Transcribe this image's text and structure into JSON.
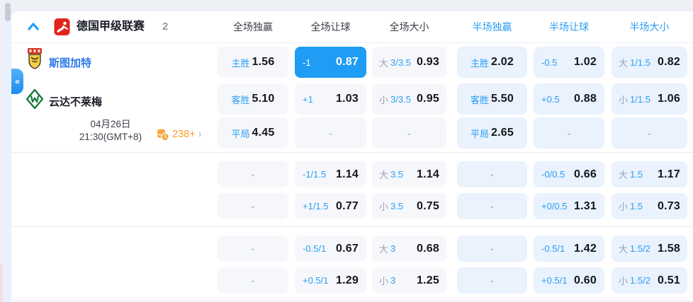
{
  "colors": {
    "accent_blue": "#1f9cf3",
    "label_blue": "#2b9ef3",
    "orange": "#f79e2e",
    "cell_ft_bg": "#f6f7fb",
    "cell_ht_bg": "#e9f2fd"
  },
  "icons": {
    "collapse_left": "«",
    "chevron_right": "›"
  },
  "header": {
    "league": "德国甲级联赛",
    "count": "2",
    "columns": [
      "全场独赢",
      "全场让球",
      "全场大小",
      "半场独赢",
      "半场让球",
      "半场大小"
    ]
  },
  "teams": {
    "home": {
      "name": "斯图加特"
    },
    "away": {
      "name": "云达不莱梅"
    }
  },
  "schedule": {
    "date": "04月26日",
    "time": "21:30(GMT+8)"
  },
  "markets": {
    "count_label": "238+"
  },
  "odds": {
    "rows": [
      {
        "cells": [
          {
            "label": "主胜",
            "value": "1.56"
          },
          {
            "label": "-1",
            "value": "0.87"
          },
          {
            "side": "大",
            "line": "3/3.5",
            "value": "0.93"
          },
          {
            "label": "主胜",
            "value": "2.02"
          },
          {
            "label": "-0.5",
            "value": "1.02"
          },
          {
            "side": "大",
            "line": "1/1.5",
            "value": "0.82"
          }
        ]
      },
      {
        "cells": [
          {
            "label": "客胜",
            "value": "5.10"
          },
          {
            "label": "+1",
            "value": "1.03"
          },
          {
            "side": "小",
            "line": "3/3.5",
            "value": "0.95"
          },
          {
            "label": "客胜",
            "value": "5.50"
          },
          {
            "label": "+0.5",
            "value": "0.88"
          },
          {
            "side": "小",
            "line": "1/1.5",
            "value": "1.06"
          }
        ]
      },
      {
        "cells": [
          {
            "label": "平局",
            "value": "4.45"
          },
          {
            "value": "-"
          },
          {
            "value": "-"
          },
          {
            "label": "平局",
            "value": "2.65"
          },
          {
            "value": "-"
          },
          {
            "value": "-"
          }
        ]
      },
      {
        "cells": [
          {
            "value": "-"
          },
          {
            "label": "-1/1.5",
            "value": "1.14"
          },
          {
            "side": "大",
            "line": "3.5",
            "value": "1.14"
          },
          {
            "value": "-"
          },
          {
            "label": "-0/0.5",
            "value": "0.66"
          },
          {
            "side": "大",
            "line": "1.5",
            "value": "1.17"
          }
        ]
      },
      {
        "cells": [
          {
            "value": "-"
          },
          {
            "label": "+1/1.5",
            "value": "0.77"
          },
          {
            "side": "小",
            "line": "3.5",
            "value": "0.75"
          },
          {
            "value": "-"
          },
          {
            "label": "+0/0.5",
            "value": "1.31"
          },
          {
            "side": "小",
            "line": "1.5",
            "value": "0.73"
          }
        ]
      },
      {
        "cells": [
          {
            "value": "-"
          },
          {
            "label": "-0.5/1",
            "value": "0.67"
          },
          {
            "side": "大",
            "line": "3",
            "value": "0.68"
          },
          {
            "value": "-"
          },
          {
            "label": "-0.5/1",
            "value": "1.42"
          },
          {
            "side": "大",
            "line": "1.5/2",
            "value": "1.58"
          }
        ]
      },
      {
        "cells": [
          {
            "value": "-"
          },
          {
            "label": "+0.5/1",
            "value": "1.29"
          },
          {
            "side": "小",
            "line": "3",
            "value": "1.25"
          },
          {
            "value": "-"
          },
          {
            "label": "+0.5/1",
            "value": "0.60"
          },
          {
            "side": "小",
            "line": "1.5/2",
            "value": "0.51"
          }
        ]
      }
    ]
  }
}
